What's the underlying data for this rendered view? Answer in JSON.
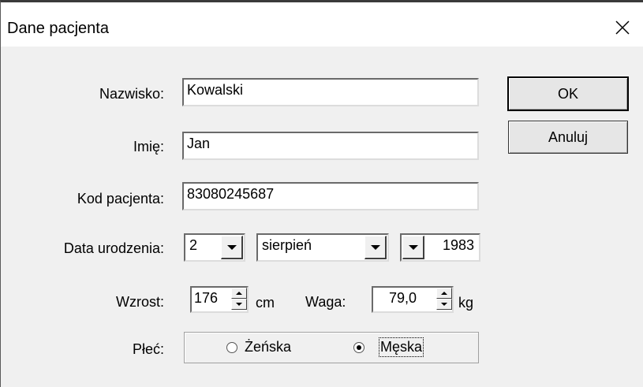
{
  "dialog": {
    "title": "Dane pacjenta",
    "close_icon": "close-icon"
  },
  "fields": {
    "surname": {
      "label": "Nazwisko:",
      "value": "Kowalski"
    },
    "firstname": {
      "label": "Imię:",
      "value": "Jan"
    },
    "patient_code": {
      "label": "Kod pacjenta:",
      "value": "83080245687"
    },
    "birth_date": {
      "label": "Data urodzenia:",
      "day": "2",
      "month": "sierpień",
      "year": "1983"
    },
    "height": {
      "label": "Wzrost:",
      "value": "176",
      "unit": "cm"
    },
    "weight": {
      "label": "Waga:",
      "value": "79,0",
      "unit": "kg"
    },
    "sex": {
      "label": "Płeć:",
      "options": [
        "Żeńska",
        "Męska"
      ],
      "selected": "Męska"
    }
  },
  "buttons": {
    "ok": "OK",
    "cancel": "Anuluj"
  }
}
